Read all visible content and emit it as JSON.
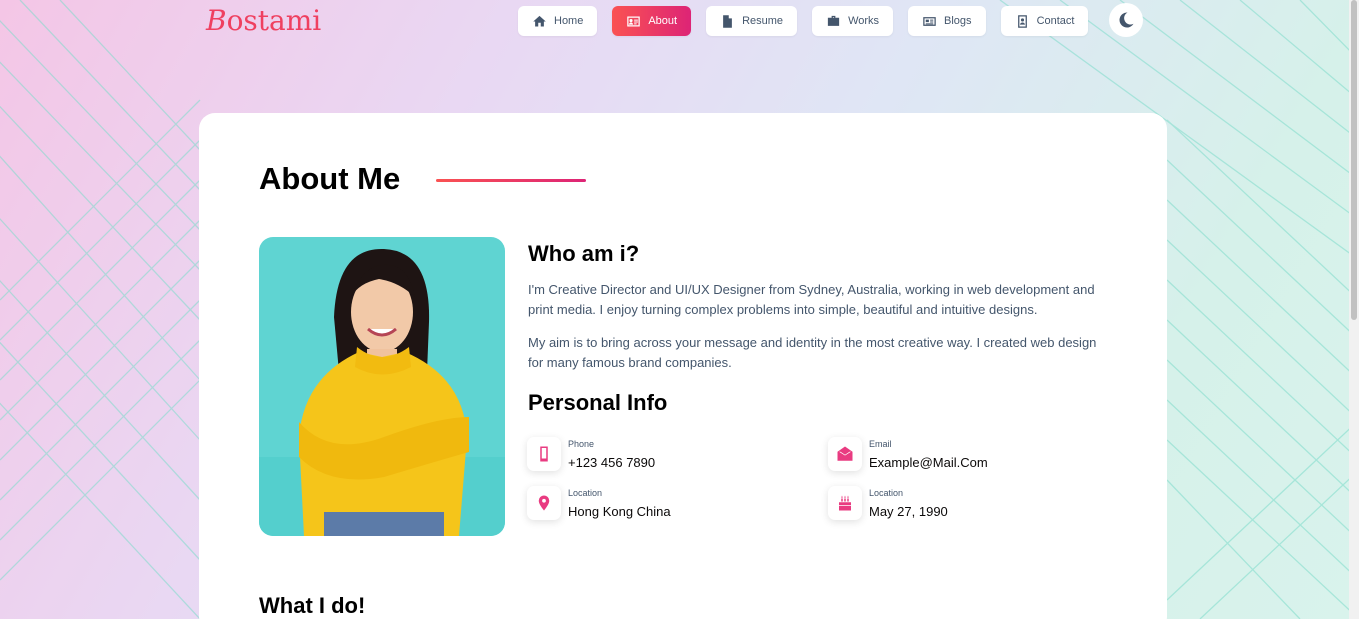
{
  "brand": {
    "first_letter": "B",
    "rest": "ostami"
  },
  "nav": {
    "items": [
      {
        "label": "Home",
        "icon": "home-icon"
      },
      {
        "label": "About",
        "icon": "id-card-icon",
        "active": true
      },
      {
        "label": "Resume",
        "icon": "file-icon"
      },
      {
        "label": "Works",
        "icon": "briefcase-icon"
      },
      {
        "label": "Blogs",
        "icon": "newspaper-icon"
      },
      {
        "label": "Contact",
        "icon": "contact-book-icon"
      }
    ],
    "theme_icon": "moon-icon"
  },
  "about": {
    "title": "About Me",
    "who_title": "Who am i?",
    "paragraphs": [
      "I'm Creative Director and UI/UX Designer from Sydney, Australia, working in web development and print media. I enjoy turning complex problems into simple, beautiful and intuitive designs.",
      "My aim is to bring across your message and identity in the most creative way. I created web design for many famous brand companies."
    ],
    "personal_info_title": "Personal Info",
    "info": {
      "phone": {
        "label": "Phone",
        "value": "+123 456 7890",
        "icon": "phone-icon"
      },
      "email": {
        "label": "Email",
        "value": "Example@Mail.Com",
        "icon": "mail-icon"
      },
      "location": {
        "label": "Location",
        "value": "Hong Kong China",
        "icon": "location-pin-icon"
      },
      "birthday": {
        "label": "Location",
        "value": "May 27, 1990",
        "icon": "cake-icon"
      }
    },
    "what_title": "What I do!"
  },
  "colors": {
    "accent_start": "#fa5252",
    "accent_end": "#dd2476",
    "icon": "#e93b81",
    "text": "#44566c"
  }
}
